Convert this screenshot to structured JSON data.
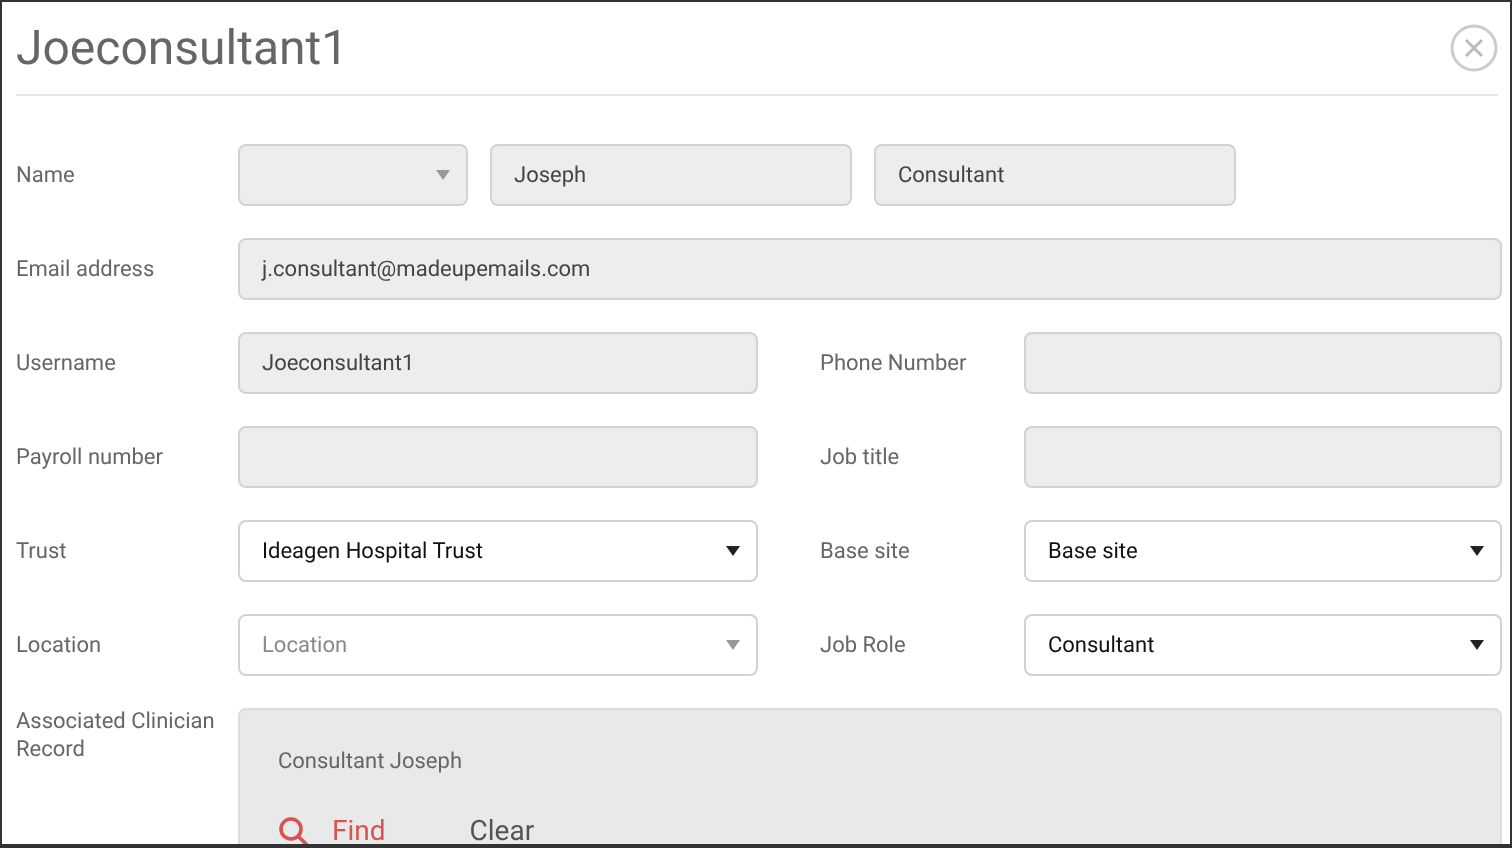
{
  "dialog": {
    "title": "Joeconsultant1"
  },
  "rows": [
    {
      "kind": "name",
      "label": "Name",
      "fields": [
        {
          "kind": "select",
          "disabled": true
        },
        {
          "kind": "text",
          "disabled": true,
          "value": "Joseph"
        },
        {
          "kind": "text",
          "disabled": true,
          "value": "Consultant"
        }
      ]
    },
    {
      "kind": "full",
      "label": "Email address",
      "fields": [
        {
          "kind": "text",
          "disabled": true,
          "value": "j.consultant@madeupemails.com"
        }
      ]
    },
    {
      "kind": "pair",
      "items": [
        {
          "label": "Username",
          "field": {
            "kind": "text",
            "disabled": true,
            "value": "Joeconsultant1"
          }
        },
        {
          "label": "Phone Number",
          "field": {
            "kind": "text",
            "disabled": true
          }
        }
      ]
    },
    {
      "kind": "pair",
      "items": [
        {
          "label": "Payroll number",
          "field": {
            "kind": "text",
            "disabled": true
          }
        },
        {
          "label": "Job title",
          "field": {
            "kind": "text",
            "disabled": true
          }
        }
      ]
    },
    {
      "kind": "pair",
      "items": [
        {
          "label": "Trust",
          "field": {
            "kind": "select",
            "disabled": false,
            "value": "Ideagen Hospital Trust"
          }
        },
        {
          "label": "Base site",
          "field": {
            "kind": "select",
            "disabled": false,
            "value": "Base site"
          }
        }
      ]
    },
    {
      "kind": "pair",
      "items": [
        {
          "label": "Location",
          "field": {
            "kind": "select",
            "disabled": false,
            "placeholder": "Location"
          }
        },
        {
          "label": "Job Role",
          "field": {
            "kind": "select",
            "disabled": false,
            "value": "Consultant"
          }
        }
      ]
    }
  ],
  "clinician_record": {
    "label": "Associated Clinician Record",
    "name": "Consultant Joseph",
    "actions": [
      {
        "kind": "find",
        "label": "Find"
      },
      {
        "kind": "clear",
        "label": "Clear"
      }
    ]
  }
}
